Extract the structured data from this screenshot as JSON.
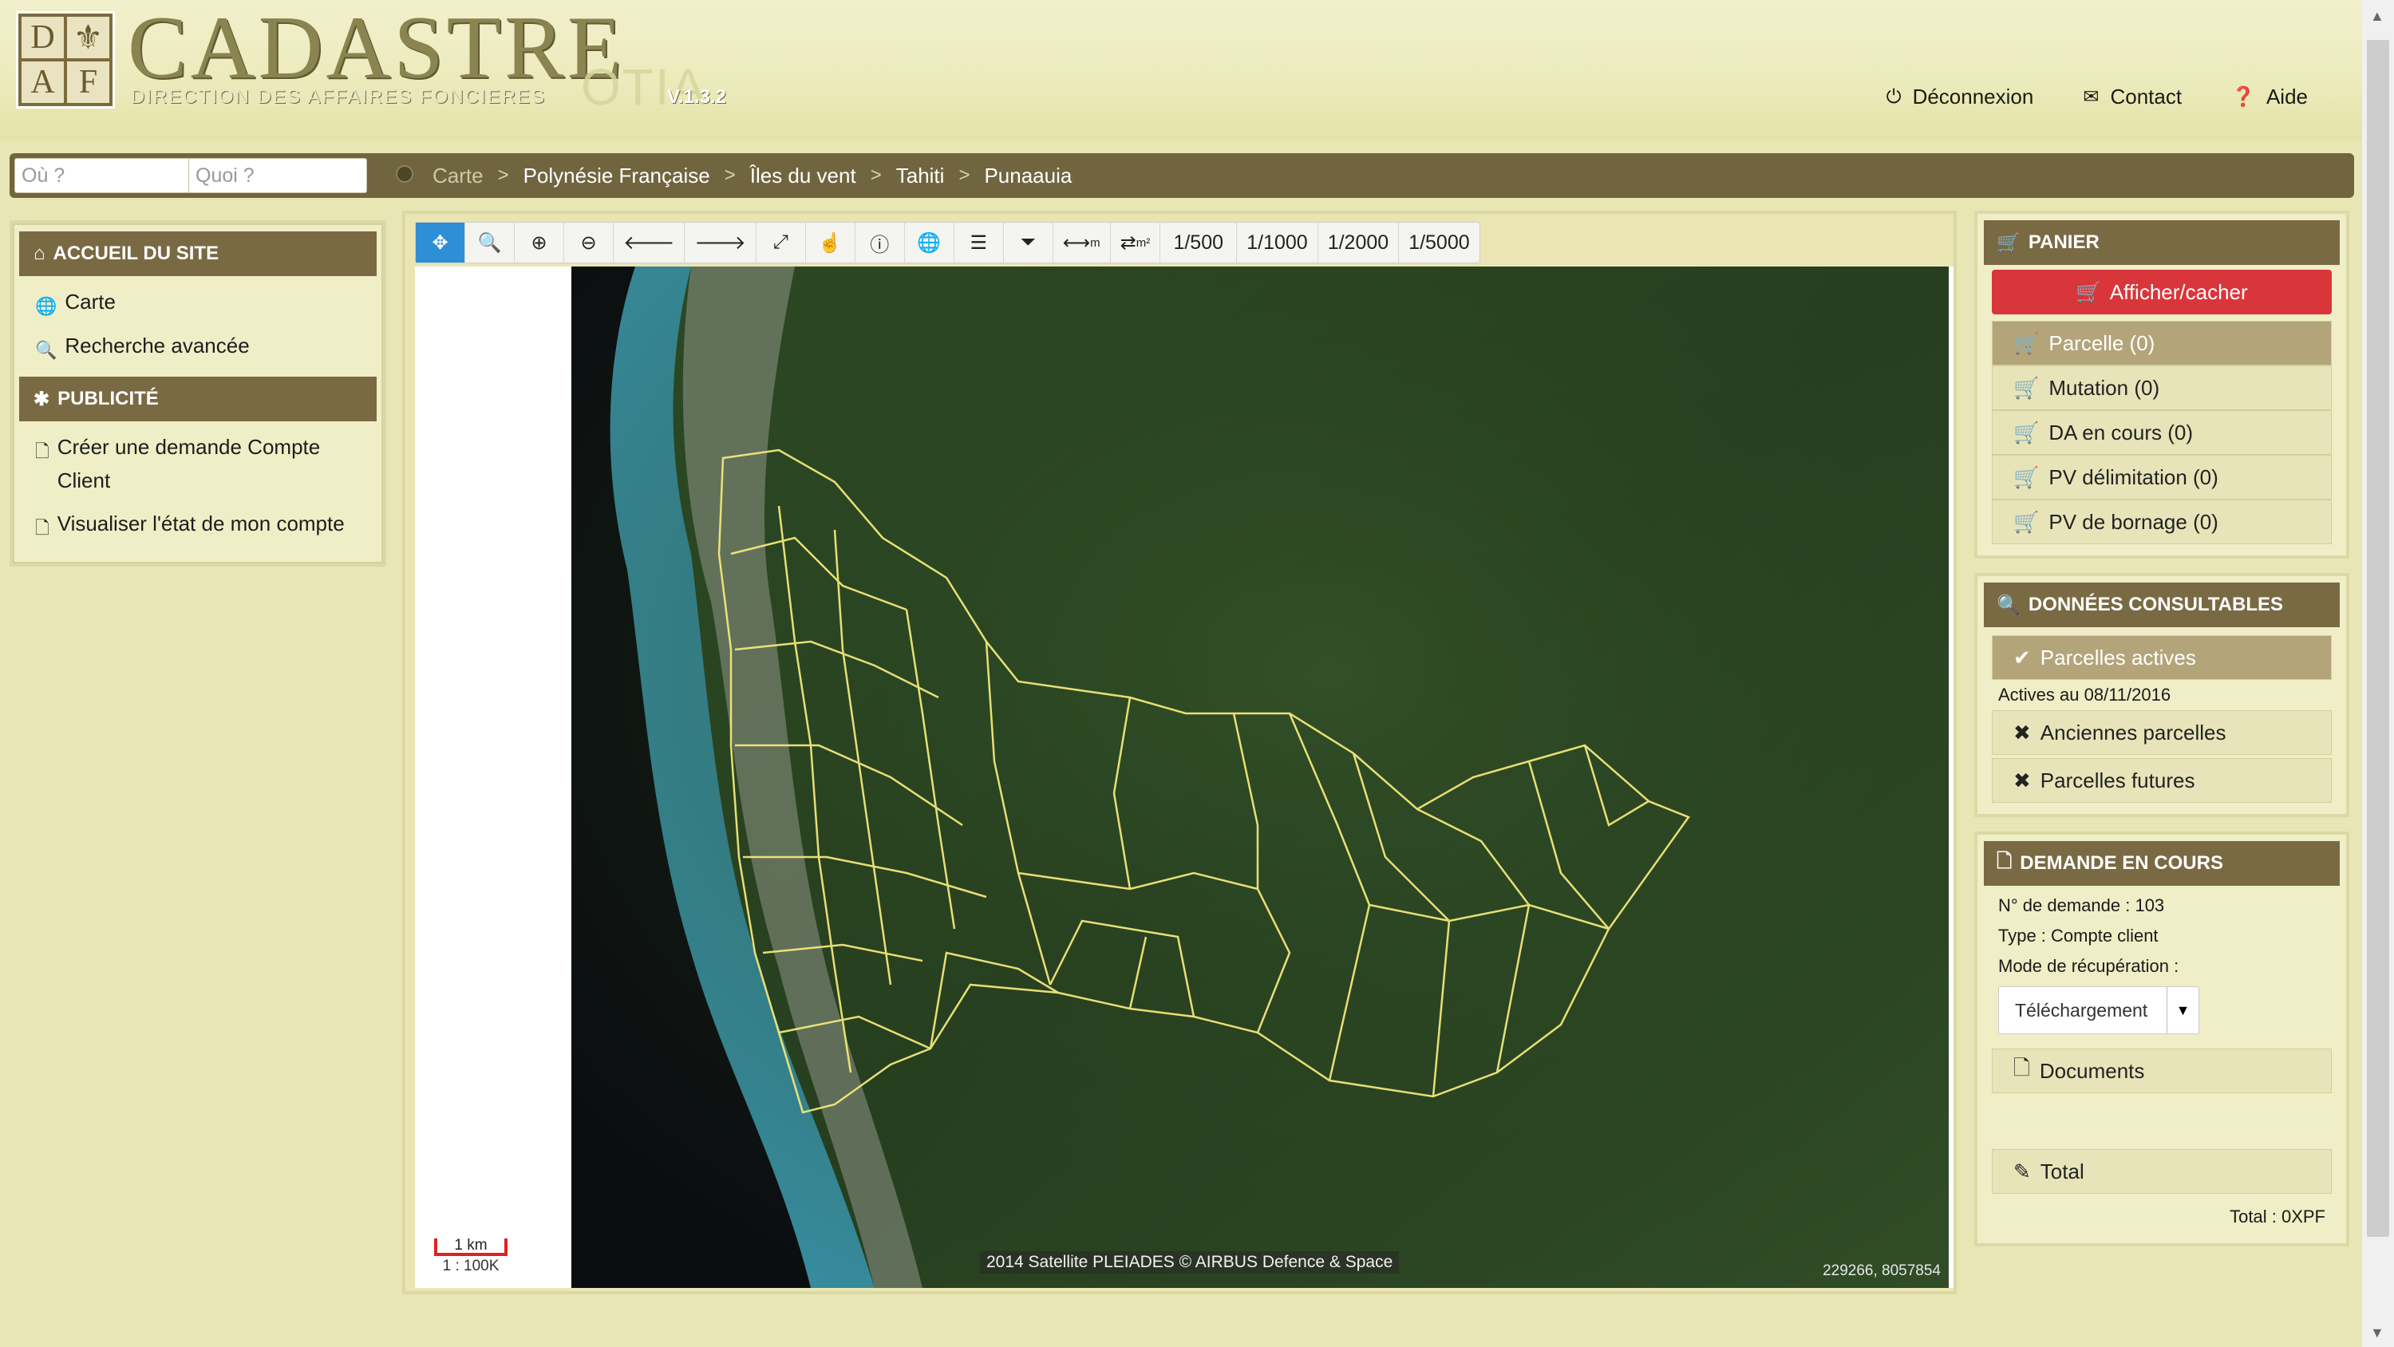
{
  "header": {
    "logo_letters": [
      "D",
      "",
      "A",
      "F"
    ],
    "title": "CADASTRE",
    "subtitle": "DIRECTION DES AFFAIRES FONCIERES",
    "product": "OTIA",
    "version": "V.1.3.2",
    "links": [
      {
        "label": "Déconnexion",
        "icon": "power-icon"
      },
      {
        "label": "Contact",
        "icon": "envelope-icon"
      },
      {
        "label": "Aide",
        "icon": "question-circle-icon"
      }
    ]
  },
  "search": {
    "where_placeholder": "Où ?",
    "what_placeholder": "Quoi ?"
  },
  "breadcrumb": {
    "items": [
      "Carte",
      "Polynésie Française",
      "Îles du vent",
      "Tahiti",
      "Punaauia"
    ],
    "separator": ">"
  },
  "left_panel": {
    "section1_title": "ACCUEIL DU SITE",
    "section1_items": [
      "Carte",
      "Recherche avancée"
    ],
    "section2_title": "PUBLICITÉ",
    "section2_items": [
      "Créer une demande Compte Client",
      "Visualiser l'état de mon compte"
    ]
  },
  "toolbar": {
    "tools": [
      "pan-icon",
      "zoom-box-icon",
      "zoom-in-icon",
      "zoom-out-icon",
      "back-icon",
      "forward-icon",
      "fullscreen-icon",
      "hand-icon",
      "info-icon",
      "globe-icon",
      "layers-list-icon",
      "filter-icon",
      "measure-length-icon",
      "measure-area-icon"
    ],
    "measure_length_label": "m",
    "measure_area_label": "m²",
    "scales": [
      "1/500",
      "1/1000",
      "1/2000",
      "1/5000"
    ]
  },
  "map": {
    "attribution": "2014 Satellite PLEIADES © AIRBUS Defence & Space",
    "coordinates": "229266, 8057854",
    "scale_label": "1 km",
    "scale_ratio": "1 : 100K",
    "parcel_color": "#f2e87a"
  },
  "panier": {
    "title": "PANIER",
    "toggle_label": "Afficher/cacher",
    "items": [
      "Parcelle (0)",
      "Mutation (0)",
      "DA en cours (0)",
      "PV délimitation (0)",
      "PV de bornage (0)"
    ]
  },
  "donnees": {
    "title": "DONNÉES CONSULTABLES",
    "active_label": "Parcelles actives",
    "active_date": "Actives au 08/11/2016",
    "old_label": "Anciennes parcelles",
    "future_label": "Parcelles futures"
  },
  "demande": {
    "title": "DEMANDE EN COURS",
    "number": "N° de demande : 103",
    "type": "Type : Compte client",
    "mode_label": "Mode de récupération :",
    "mode_value": "Téléchargement",
    "documents_label": "Documents",
    "total_label": "Total",
    "total_value": "Total : 0XPF"
  },
  "colors": {
    "panel_header": "#7a6a44",
    "accent_red": "#d9363b",
    "accent_blue": "#2f8fd6"
  }
}
